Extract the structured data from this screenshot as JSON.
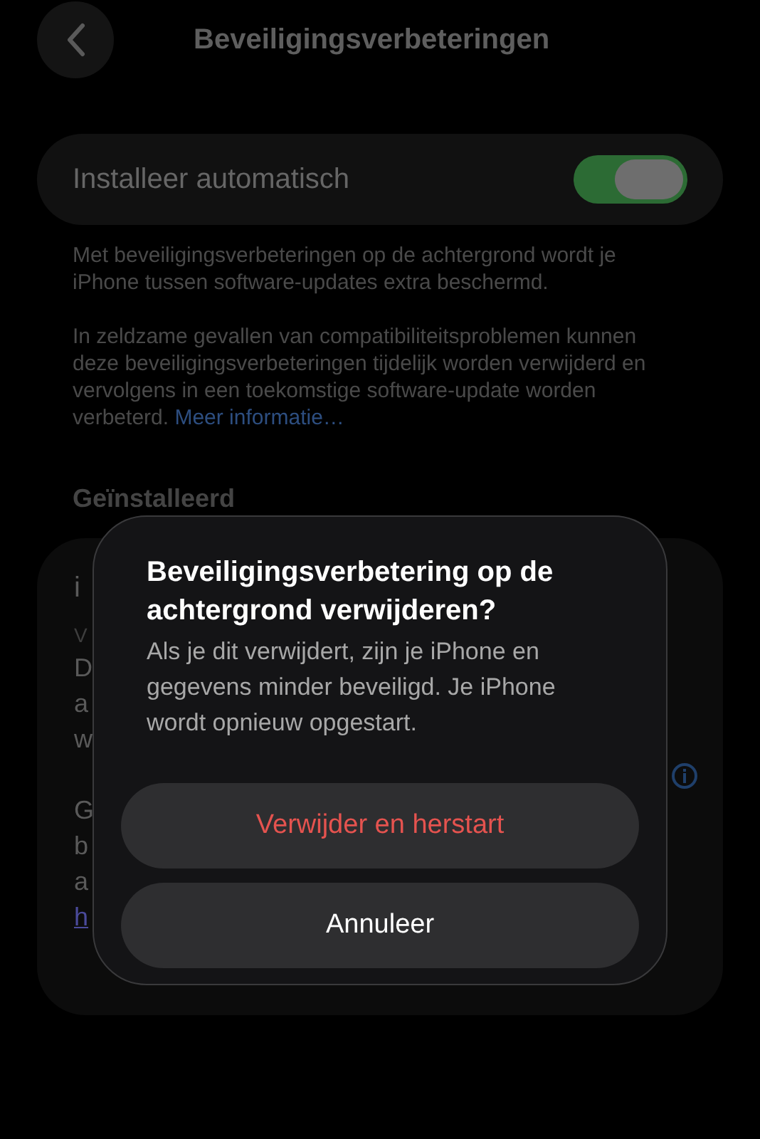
{
  "nav": {
    "title": "Beveiligingsverbeteringen"
  },
  "auto_install": {
    "label": "Installeer automatisch",
    "on": true
  },
  "footer": {
    "paragraphs": [
      "Met beveiligingsverbeteringen op de achtergrond wordt je iPhone tussen software-updates extra beschermd.",
      "In zeldzame gevallen van compatibiliteitsproblemen kunnen deze beveiligingsverbeteringen tijdelijk worden verwijderd en vervolgens in een toekomstige software-update worden verbeterd."
    ],
    "link": "Meer informatie…"
  },
  "installed": {
    "heading": "Geïnstalleerd",
    "lines": [
      {
        "kind": "title",
        "text": "i"
      },
      {
        "kind": "subtitle",
        "text": "V"
      },
      {
        "kind": "body",
        "text": "D"
      },
      {
        "kind": "body",
        "text": "a"
      },
      {
        "kind": "body",
        "text": "w"
      },
      {
        "kind": "gap",
        "text": "G"
      },
      {
        "kind": "body",
        "text": "b"
      },
      {
        "kind": "body",
        "text": "a"
      },
      {
        "kind": "link",
        "text": "h"
      }
    ]
  },
  "dialog": {
    "title": "Beveiligingsverbetering op de achtergrond verwijderen?",
    "message": "Als je dit verwijdert, zijn je iPhone en gegevens minder beveiligd. Je iPhone wordt opnieuw opgestart.",
    "buttons": [
      {
        "label": "Verwijder en herstart",
        "kind": "destructive"
      },
      {
        "label": "Annuleer",
        "kind": "cancel"
      }
    ]
  }
}
